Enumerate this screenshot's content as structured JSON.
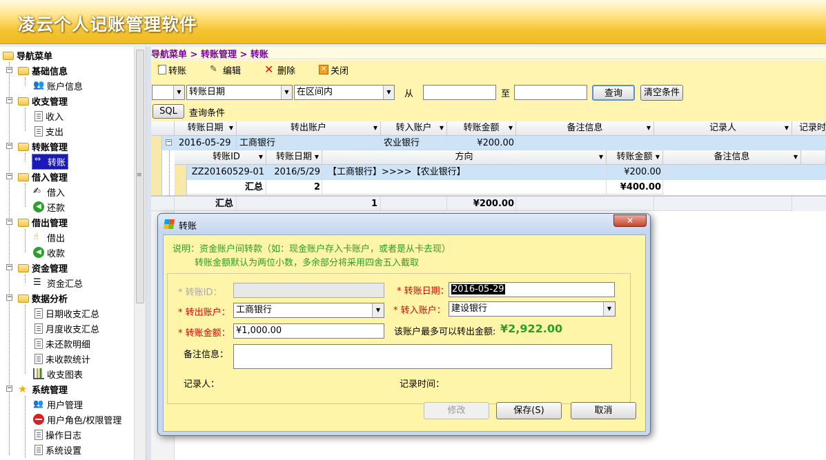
{
  "app": {
    "title": "凌云个人记账管理软件"
  },
  "sidebar": {
    "root": "导航菜单",
    "groups": [
      {
        "label": "基础信息",
        "items": [
          "账户信息"
        ]
      },
      {
        "label": "收支管理",
        "items": [
          "收入",
          "支出"
        ]
      },
      {
        "label": "转账管理",
        "items": [
          "转账"
        ]
      },
      {
        "label": "借入管理",
        "items": [
          "借入",
          "还款"
        ]
      },
      {
        "label": "借出管理",
        "items": [
          "借出",
          "收款"
        ]
      },
      {
        "label": "资金管理",
        "items": [
          "资金汇总"
        ]
      },
      {
        "label": "数据分析",
        "items": [
          "日期收支汇总",
          "月度收支汇总",
          "未还款明细",
          "未收款统计",
          "收支图表"
        ]
      },
      {
        "label": "系统管理",
        "items": [
          "用户管理",
          "用户角色/权限管理",
          "操作日志",
          "系统设置"
        ]
      }
    ]
  },
  "breadcrumb": "导航菜单 > 转账管理 > 转账",
  "toolbar": {
    "transfer": "转账",
    "edit": "编辑",
    "delete": "删除",
    "close": "关闭"
  },
  "filter": {
    "field": "转账日期",
    "operator": "在区间内",
    "from_label": "从",
    "to_label": "至",
    "query": "查询",
    "clear": "清空条件",
    "sql": "SQL",
    "condition_label": "查询条件"
  },
  "grid": {
    "headers": [
      "转账日期",
      "转出账户",
      "转入账户",
      "转账金额",
      "备注信息",
      "记录人",
      "记录时"
    ],
    "row": {
      "date": "2016-05-29",
      "out": "工商银行",
      "in": "农业银行",
      "amount": "¥200.00"
    },
    "detail_headers": [
      "转账ID",
      "转账日期",
      "方向",
      "转账金额",
      "备注信息"
    ],
    "detail_row": {
      "id": "ZZ20160529-01",
      "date": "2016/5/29",
      "direction": "【工商银行】>>>>【农业银行】",
      "amount": "¥200.00"
    },
    "detail_total": {
      "label": "汇总",
      "count": "2",
      "amount": "¥400.00"
    },
    "total": {
      "label": "汇总",
      "count": "1",
      "amount": "¥200.00"
    }
  },
  "dialog": {
    "title": "转账",
    "note1": "说明：资金账户间转款（如：现金账户存入卡账户，或者是从卡去现）",
    "note2": "转账金额默认为两位小数，多余部分将采用四舍五入截取",
    "id_label": "* 转账ID：",
    "date_label": "* 转账日期：",
    "date_value": "2016-05-29",
    "out_label": "* 转出账户：",
    "out_value": "工商银行",
    "in_label": "* 转入账户：",
    "in_value": "建设银行",
    "amount_label": "* 转账金额：",
    "amount_value": "¥1,000.00",
    "max_label": "该账户最多可以转出金额:",
    "max_value": "¥2,922.00",
    "remark_label": "备注信息：",
    "recorder_label": "记录人：",
    "record_time_label": "记录时间：",
    "modify": "修改",
    "save": "保存(S)",
    "cancel": "取消"
  },
  "colors": {
    "accent": "#1a1ab8",
    "note_green": "#2aa020",
    "required_red": "#e00000",
    "toolbar_yellow": "#fff5b0"
  }
}
